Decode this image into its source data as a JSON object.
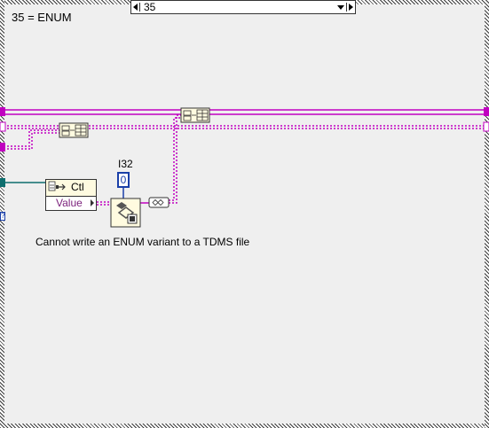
{
  "case_label": "35 = ENUM",
  "case_selector": {
    "value": "35"
  },
  "property_node": {
    "class_label": "Ctl",
    "property": "Value"
  },
  "constant": {
    "type_label": "I32",
    "value": "0"
  },
  "comment": "Cannot write an ENUM variant to a TDMS file",
  "colors": {
    "variant_wire": "#c000c0",
    "refnum_wire": "#0f6f6f",
    "int_wire": "#1a3fa8",
    "background": "#efefef"
  }
}
